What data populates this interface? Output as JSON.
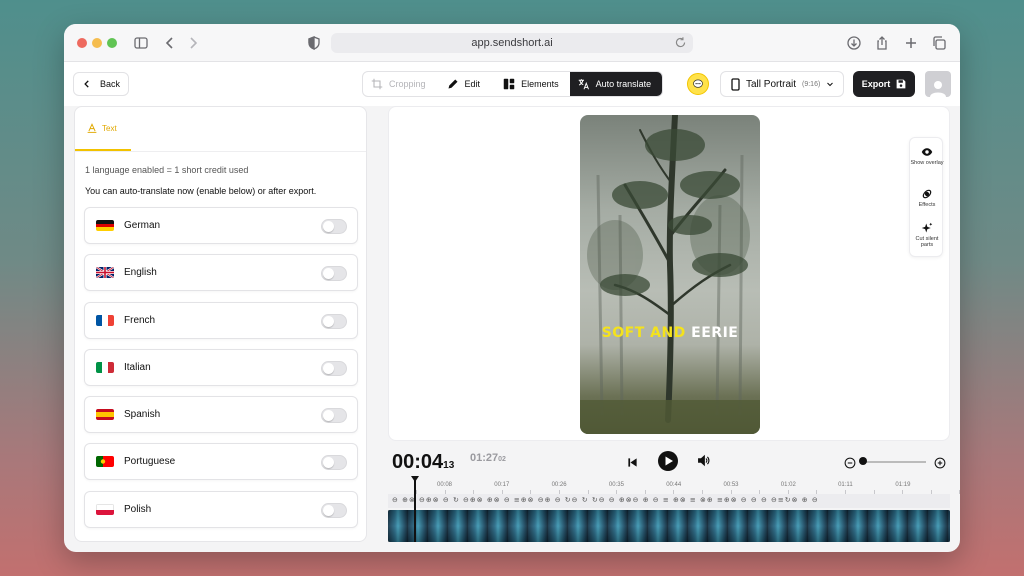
{
  "browser": {
    "url": "app.sendshort.ai"
  },
  "toolbar": {
    "back_label": "Back",
    "modes": [
      {
        "label": "Cropping",
        "state": "disabled"
      },
      {
        "label": "Edit",
        "state": "normal"
      },
      {
        "label": "Elements",
        "state": "normal"
      },
      {
        "label": "Auto translate",
        "state": "active"
      }
    ],
    "aspect_label": "Tall Portrait",
    "aspect_ratio": "(9:16)",
    "export_label": "Export"
  },
  "panel": {
    "tab_label": "Text",
    "credit_note": "1 language enabled = 1 short credit used",
    "instruction": "You can auto-translate now (enable below) or after export.",
    "languages": [
      {
        "name": "German",
        "enabled": false,
        "flag": "de"
      },
      {
        "name": "English",
        "enabled": false,
        "flag": "gb"
      },
      {
        "name": "French",
        "enabled": false,
        "flag": "fr"
      },
      {
        "name": "Italian",
        "enabled": false,
        "flag": "it"
      },
      {
        "name": "Spanish",
        "enabled": false,
        "flag": "es"
      },
      {
        "name": "Portuguese",
        "enabled": false,
        "flag": "pt"
      },
      {
        "name": "Polish",
        "enabled": false,
        "flag": "pl"
      }
    ]
  },
  "preview": {
    "caption_word1": "SOFT AND",
    "caption_word2": "EERIE"
  },
  "side_tools": [
    {
      "label": "Show overlay",
      "icon": "eye-icon"
    },
    {
      "label": "Effects",
      "icon": "effects-icon"
    },
    {
      "label": "Cut silent parts",
      "icon": "sparkle-icon"
    }
  ],
  "timeline": {
    "current_time": "00:04",
    "current_frames": "13",
    "total_time": "01:27",
    "total_frames": "02",
    "ruler_labels": [
      "00:08",
      "00:17",
      "00:26",
      "00:35",
      "00:44",
      "00:53",
      "01:02",
      "01:11",
      "01:19"
    ]
  },
  "colors": {
    "accent": "#f2c200",
    "caption_yellow": "#f4e21c",
    "dark": "#1f1f22"
  }
}
